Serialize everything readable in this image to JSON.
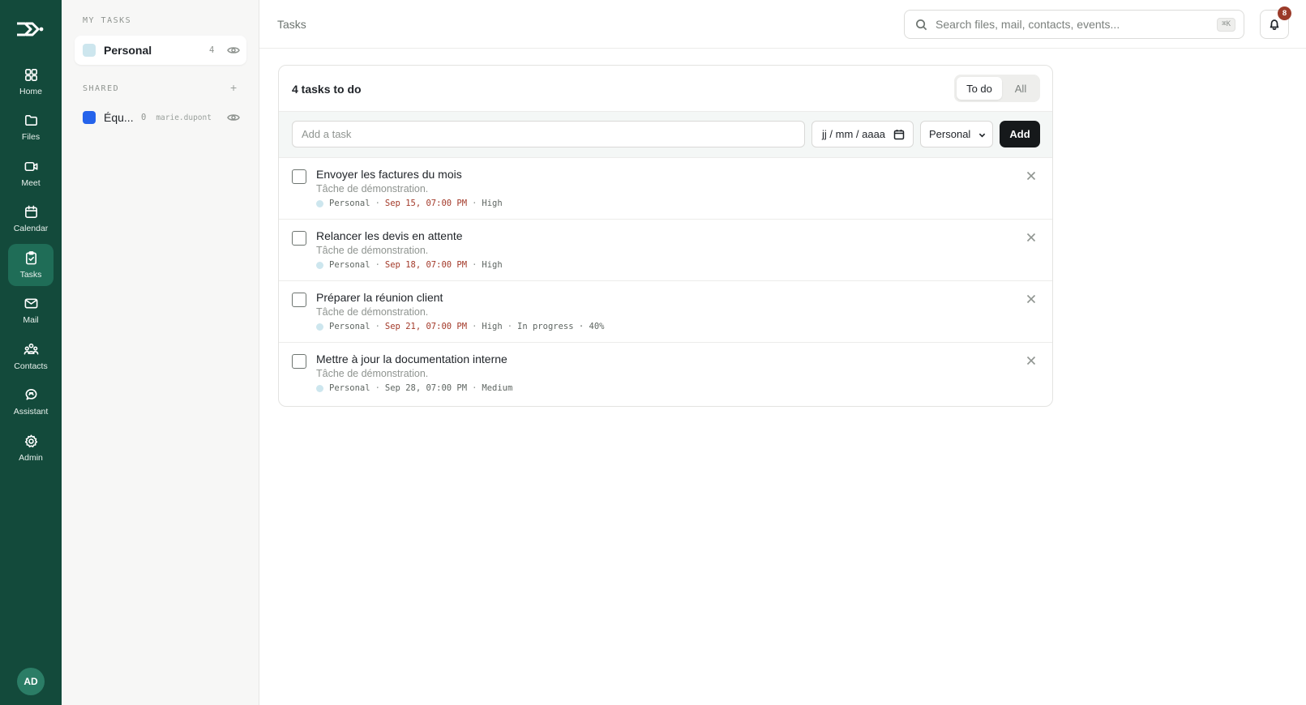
{
  "rail": {
    "items": [
      {
        "label": "Home",
        "icon": "home-icon"
      },
      {
        "label": "Files",
        "icon": "folder-icon"
      },
      {
        "label": "Meet",
        "icon": "video-icon"
      },
      {
        "label": "Calendar",
        "icon": "calendar-icon"
      },
      {
        "label": "Tasks",
        "icon": "tasks-icon",
        "active": true
      },
      {
        "label": "Mail",
        "icon": "mail-icon"
      },
      {
        "label": "Contacts",
        "icon": "contacts-icon"
      },
      {
        "label": "Assistant",
        "icon": "assistant-icon"
      },
      {
        "label": "Admin",
        "icon": "gear-icon"
      }
    ],
    "avatar": "AD",
    "colors": {
      "background": "#134a3b",
      "active": "#1f6d57"
    }
  },
  "sidebar": {
    "my_tasks_title": "MY TASKS",
    "shared_title": "SHARED",
    "add_shared_label": "+",
    "my_lists": [
      {
        "name": "Personal",
        "count": "4",
        "color": "#cde6ee"
      }
    ],
    "shared_lists": [
      {
        "name": "Équ...",
        "count": "0",
        "owner": "marie.dupont",
        "color": "#2563eb"
      }
    ]
  },
  "header": {
    "title": "Tasks",
    "search": {
      "placeholder": "Search files, mail, contacts, events...",
      "shortcut": "⌘K"
    },
    "notifications_count": "8"
  },
  "main": {
    "heading": "4 tasks to do",
    "filters": [
      "To do",
      "All"
    ],
    "active_filter": "To do",
    "add_form": {
      "placeholder": "Add a task",
      "date_placeholder": "jj / mm / aaaa",
      "list_value": "Personal",
      "add_label": "Add"
    },
    "tasks": [
      {
        "title": "Envoyer les factures du mois",
        "description": "Tâche de démonstration.",
        "list": "Personal",
        "due": "Sep 15, 07:00 PM",
        "priority": "High",
        "extra": ""
      },
      {
        "title": "Relancer les devis en attente",
        "description": "Tâche de démonstration.",
        "list": "Personal",
        "due": "Sep 18, 07:00 PM",
        "priority": "High",
        "extra": ""
      },
      {
        "title": "Préparer la réunion client",
        "description": "Tâche de démonstration.",
        "list": "Personal",
        "due": "Sep 21, 07:00 PM",
        "priority": "High",
        "extra": "In progress · 40%"
      },
      {
        "title": "Mettre à jour la documentation interne",
        "description": "Tâche de démonstration.",
        "list": "Personal",
        "due": "Sep 28, 07:00 PM",
        "priority": "Medium",
        "extra": ""
      }
    ],
    "colors": {
      "overdue": "#a33a2a",
      "add_button": "#16191b"
    }
  }
}
